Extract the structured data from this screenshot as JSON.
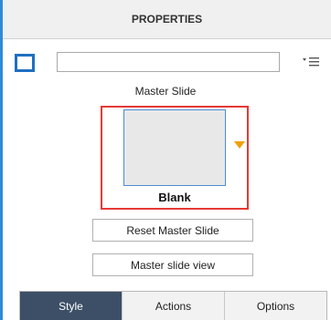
{
  "header": {
    "title": "PROPERTIES"
  },
  "slide": {
    "name_value": "",
    "section_label": "Master Slide",
    "master_thumbnail_caption": "Blank"
  },
  "icons": {
    "slide_type": "slide-icon",
    "options_menu": "menu-icon",
    "dropdown": "triangle-down-icon"
  },
  "buttons": {
    "reset": "Reset Master Slide",
    "view": "Master slide view"
  },
  "tabs": [
    {
      "label": "Style",
      "active": true
    },
    {
      "label": "Actions",
      "active": false
    },
    {
      "label": "Options",
      "active": false
    }
  ],
  "colors": {
    "accent_blue": "#1f6fc0",
    "highlight_red": "#e53935",
    "arrow_orange": "#f0a000",
    "active_tab": "#3c4f66"
  }
}
